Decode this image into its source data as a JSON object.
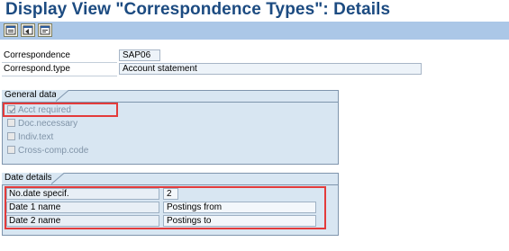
{
  "window": {
    "title": "Display View \"Correspondence Types\": Details"
  },
  "toolbar": {
    "buttons": [
      {
        "icon": "other-entry-icon"
      },
      {
        "icon": "previous-entry-icon"
      },
      {
        "icon": "next-entry-icon"
      }
    ]
  },
  "header_fields": {
    "correspondence": {
      "label": "Correspondence",
      "value": "SAP06"
    },
    "correspond_type": {
      "label": "Correspond.type",
      "value": "Account statement"
    }
  },
  "general_data": {
    "title": "General data",
    "checkboxes": [
      {
        "label": "Acct required",
        "checked": true
      },
      {
        "label": "Doc.necessary",
        "checked": false
      },
      {
        "label": "Indiv.text",
        "checked": false
      },
      {
        "label": "Cross-comp.code",
        "checked": false
      }
    ]
  },
  "date_details": {
    "title": "Date details",
    "rows": [
      {
        "label": "No.date specif.",
        "value": "2"
      },
      {
        "label": "Date 1 name",
        "value": "Postings from"
      },
      {
        "label": "Date 2 name",
        "value": "Postings to"
      }
    ]
  },
  "colors": {
    "title": "#1c4b81",
    "toolbar": "#abc7e7",
    "group_bg": "#d8e6f2",
    "highlight": "#e33b3b"
  }
}
